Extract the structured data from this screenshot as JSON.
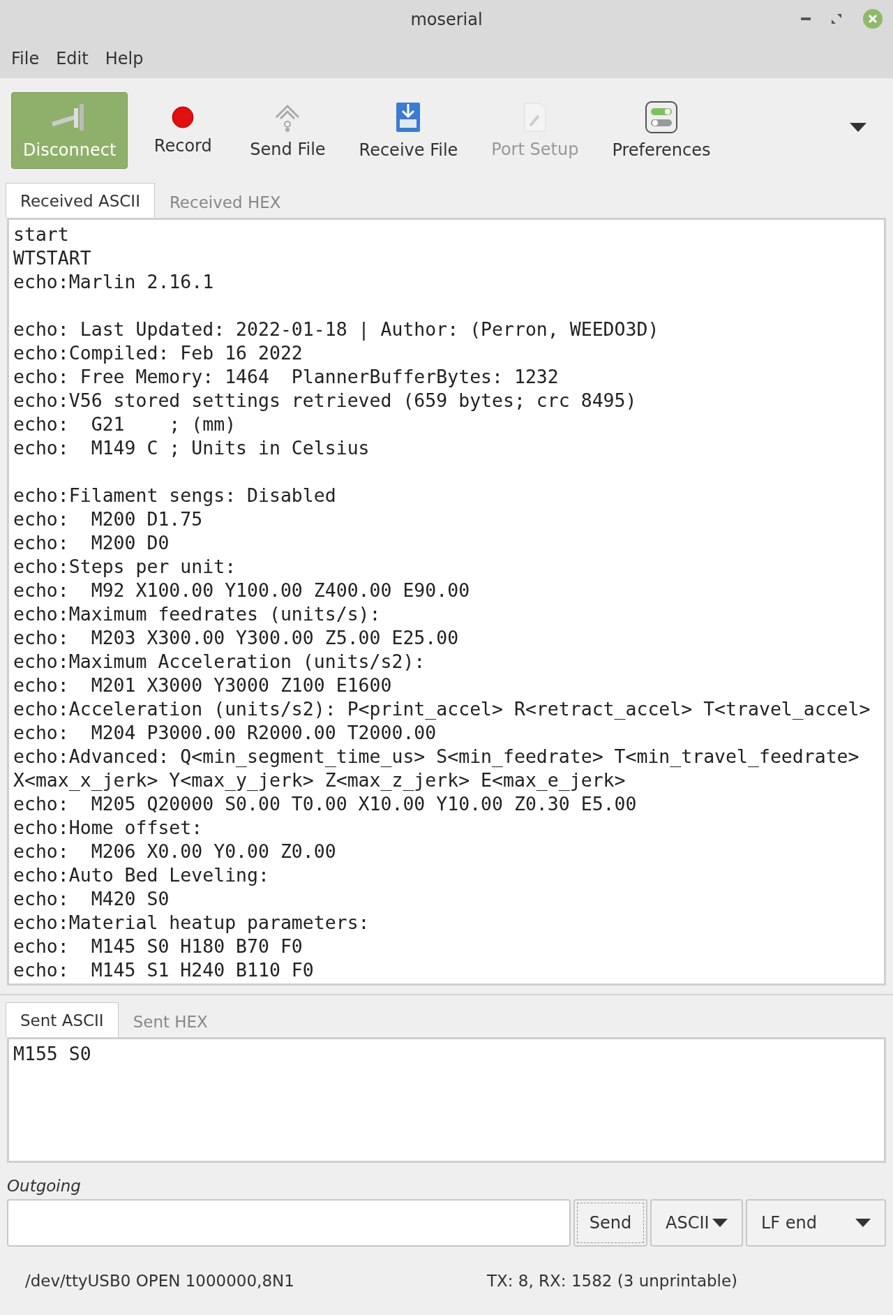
{
  "window": {
    "title": "moserial"
  },
  "menu": [
    "File",
    "Edit",
    "Help"
  ],
  "toolbar": [
    {
      "label": "Disconnect",
      "active": true,
      "disabled": false
    },
    {
      "label": "Record",
      "active": false,
      "disabled": false
    },
    {
      "label": "Send File",
      "active": false,
      "disabled": false
    },
    {
      "label": "Receive File",
      "active": false,
      "disabled": false
    },
    {
      "label": "Port Setup",
      "active": false,
      "disabled": true
    },
    {
      "label": "Preferences",
      "active": false,
      "disabled": false
    }
  ],
  "received": {
    "tabs": [
      {
        "label": "Received ASCII",
        "selected": true
      },
      {
        "label": "Received HEX",
        "selected": false
      }
    ],
    "blocks": [
      [
        "start",
        "WTSTART",
        "echo:Marlin 2.16.1"
      ],
      [
        "echo: Last Updated: 2022-01-18 | Author: (Perron, WEEDO3D)",
        "echo:Compiled: Feb 16 2022",
        "echo: Free Memory: 1464  PlannerBufferBytes: 1232",
        "echo:V56 stored settings retrieved (659 bytes; crc 8495)",
        "echo:  G21    ; (mm)",
        "echo:  M149 C ; Units in Celsius"
      ],
      [
        "echo:Filament sengs: Disabled",
        "echo:  M200 D1.75",
        "echo:  M200 D0",
        "echo:Steps per unit:",
        "echo:  M92 X100.00 Y100.00 Z400.00 E90.00",
        "echo:Maximum feedrates (units/s):",
        "echo:  M203 X300.00 Y300.00 Z5.00 E25.00",
        "echo:Maximum Acceleration (units/s2):",
        "echo:  M201 X3000 Y3000 Z100 E1600",
        "echo:Acceleration (units/s2): P<print_accel> R<retract_accel> T<travel_accel>",
        "echo:  M204 P3000.00 R2000.00 T2000.00",
        "echo:Advanced: Q<min_segment_time_us> S<min_feedrate> T<min_travel_feedrate>",
        "X<max_x_jerk> Y<max_y_jerk> Z<max_z_jerk> E<max_e_jerk>",
        "echo:  M205 Q20000 S0.00 T0.00 X10.00 Y10.00 Z0.30 E5.00",
        "echo:Home offset:",
        "echo:  M206 X0.00 Y0.00 Z0.00",
        "echo:Auto Bed Leveling:",
        "echo:  M420 S0",
        "echo:Material heatup parameters:",
        "echo:  M145 S0 H180 B70 F0",
        "echo:  M145 S1 H240 B110 F0"
      ]
    ]
  },
  "sent": {
    "tabs": [
      {
        "label": "Sent ASCII",
        "selected": true
      },
      {
        "label": "Sent HEX",
        "selected": false
      }
    ],
    "lines": [
      "M155 S0"
    ]
  },
  "outgoing": {
    "label": "Outgoing",
    "send": "Send",
    "format": "ASCII",
    "line_end": "LF end"
  },
  "status": {
    "port": "/dev/ttyUSB0 OPEN 1000000,8N1",
    "counts": "TX: 8, RX: 1582 (3 unprintable)"
  }
}
